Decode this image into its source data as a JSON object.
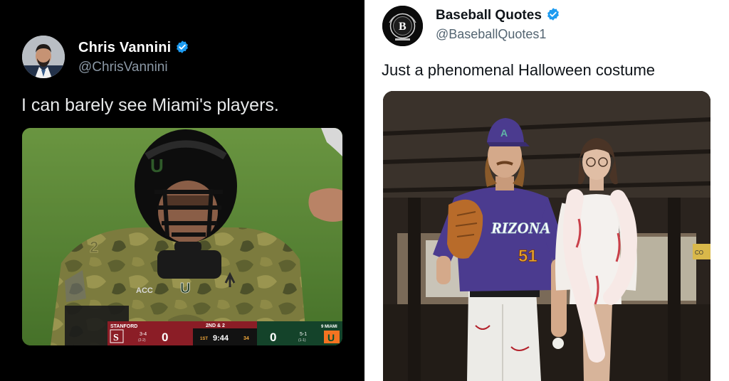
{
  "left_tweet": {
    "author_name": "Chris Vannini",
    "author_handle": "@ChrisVannini",
    "text": "I can barely see Miami's players.",
    "verified_color": "#1d9bf0",
    "background": "#000000",
    "scoreboard": {
      "home_team": "STANFORD",
      "home_record": "3-4",
      "home_conf_record": "(2-2)",
      "home_score": "0",
      "down_distance": "2ND & 2",
      "quarter": "1ST",
      "clock": "9:44",
      "play_clock": "34",
      "away_rank_team": "9 MIAMI",
      "away_record": "5-1",
      "away_conf_record": "(1-1)",
      "away_score": "0",
      "away_logo": "U"
    },
    "jersey": {
      "helmet_logo": "U",
      "chest_logo": "U",
      "patch_text": "ACC"
    }
  },
  "right_tweet": {
    "author_name": "Baseball Quotes",
    "author_handle": "@BaseballQuotes1",
    "text": "Just a phenomenal Halloween costume",
    "verified_color": "#1d9bf0",
    "avatar_letter": "B",
    "jersey": {
      "team_text": "RIZONA",
      "number": "51",
      "cap_letter": "A"
    }
  }
}
